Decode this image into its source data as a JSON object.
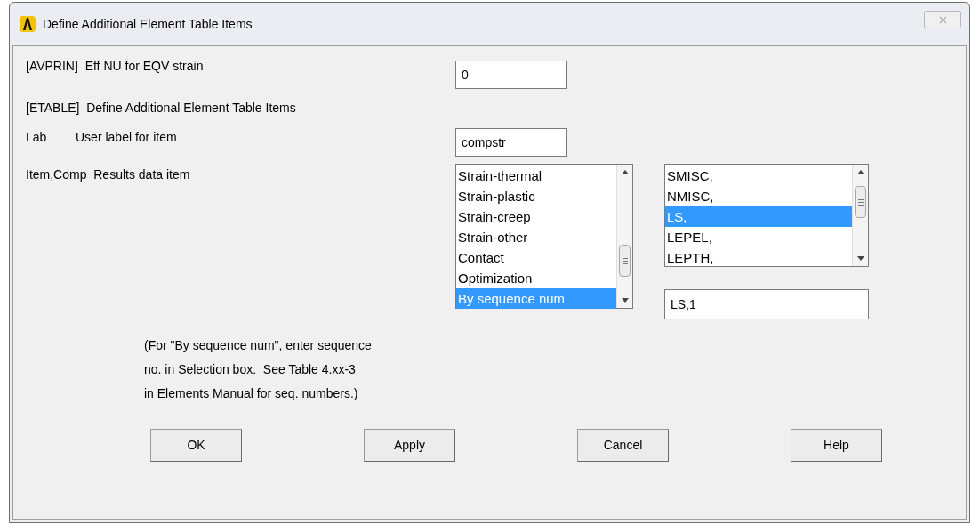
{
  "window": {
    "title": "Define Additional Element Table Items"
  },
  "avprin": {
    "label": "[AVPRIN]  Eff NU for EQV strain",
    "value": "0"
  },
  "etable": {
    "heading": "[ETABLE]  Define Additional Element Table Items"
  },
  "lab": {
    "key": "Lab",
    "label": "User label for item",
    "value": "compstr"
  },
  "item": {
    "label": "Item,Comp  Results data item",
    "items": [
      {
        "text": "Strain-thermal",
        "selected": false
      },
      {
        "text": "Strain-plastic",
        "selected": false
      },
      {
        "text": "Strain-creep",
        "selected": false
      },
      {
        "text": "Strain-other",
        "selected": false
      },
      {
        "text": "Contact",
        "selected": false
      },
      {
        "text": "Optimization",
        "selected": false
      },
      {
        "text": "By sequence num",
        "selected": true
      }
    ],
    "comps": [
      {
        "text": "SMISC,",
        "selected": false
      },
      {
        "text": "NMISC,",
        "selected": false
      },
      {
        "text": "LS,",
        "selected": true
      },
      {
        "text": "LEPEL,",
        "selected": false
      },
      {
        "text": "LEPTH,",
        "selected": false
      }
    ],
    "selection": "LS,1"
  },
  "note": [
    "(For \"By sequence num\", enter sequence",
    "no. in Selection box.  See Table 4.xx-3",
    "in Elements Manual for seq. numbers.)"
  ],
  "buttons": [
    "OK",
    "Apply",
    "Cancel",
    "Help"
  ]
}
